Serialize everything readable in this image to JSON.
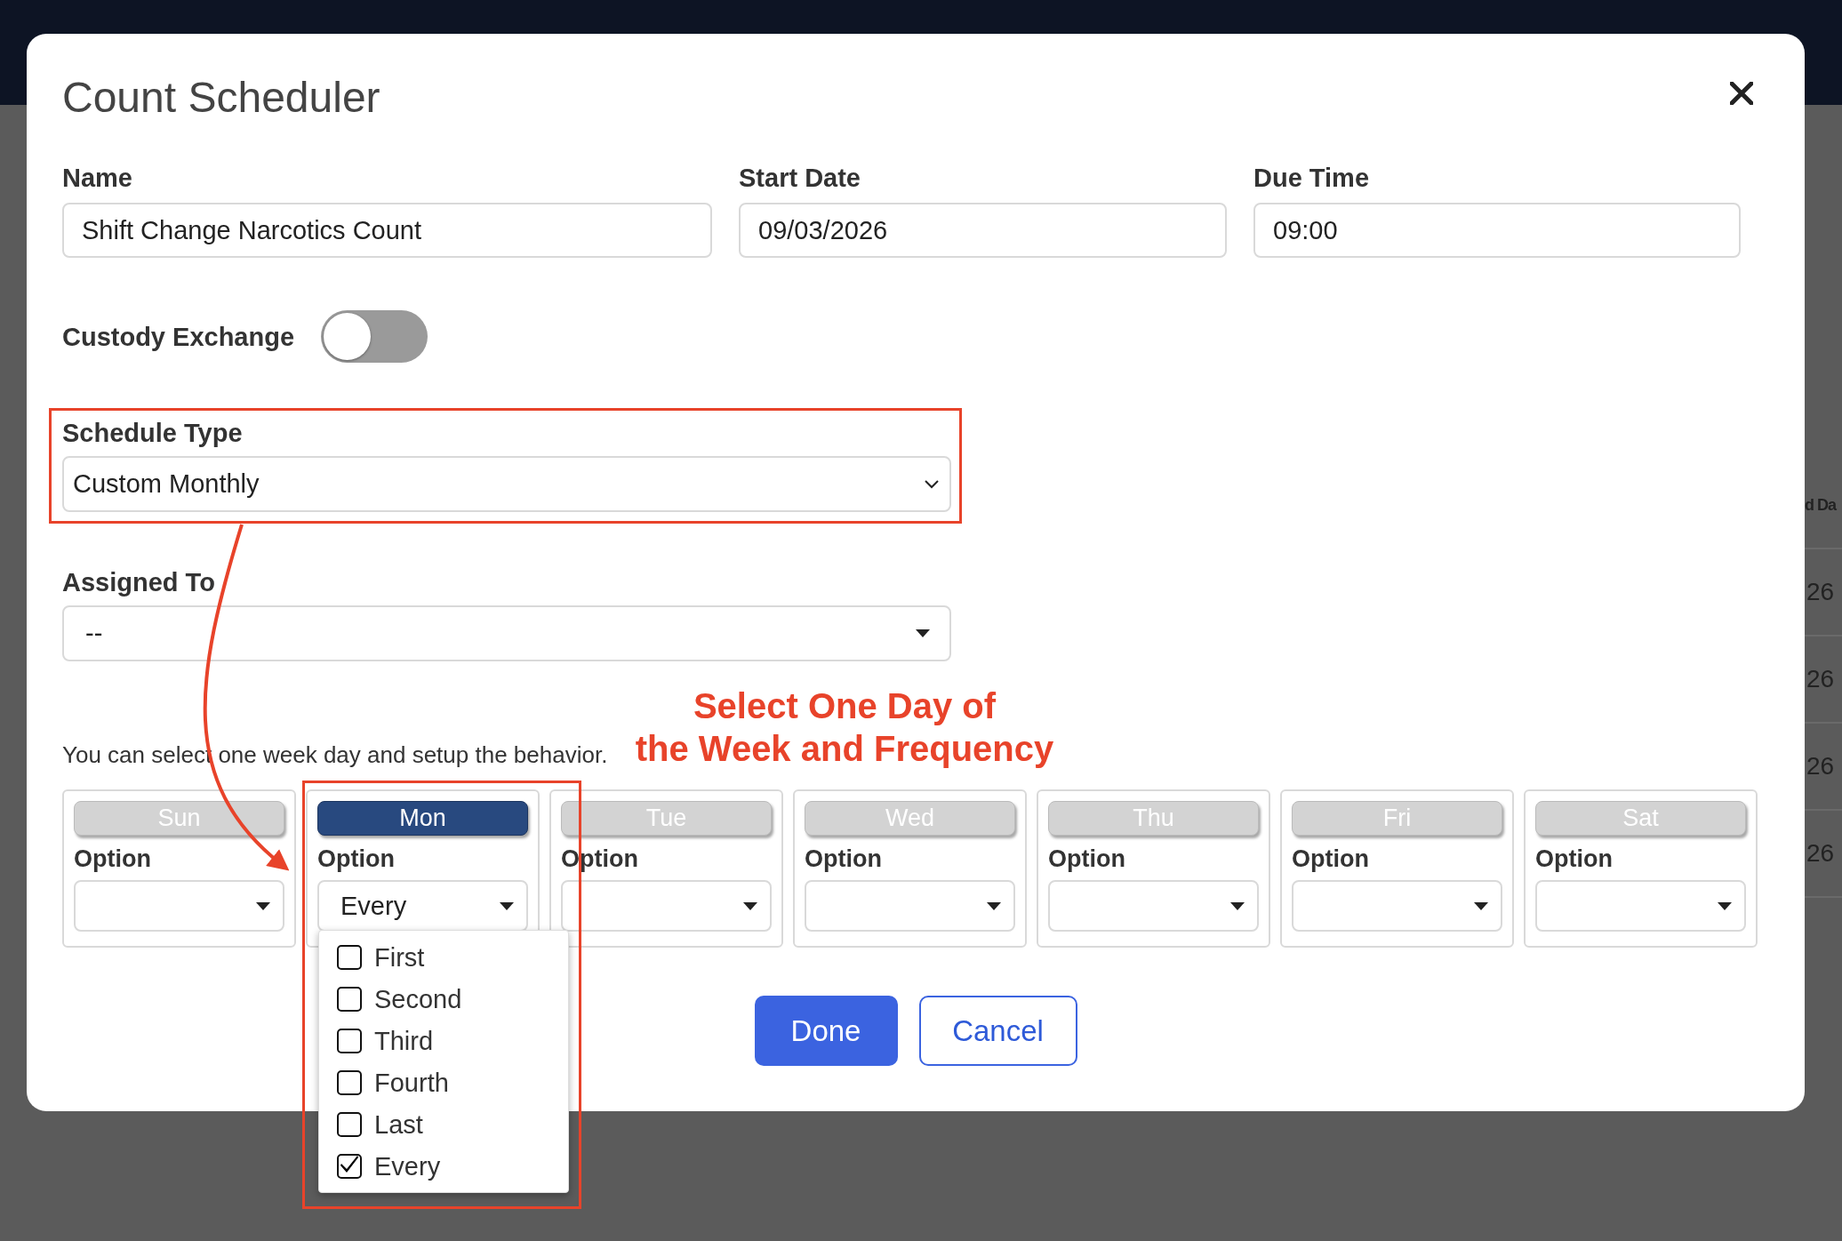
{
  "modal": {
    "title": "Count Scheduler"
  },
  "fields": [
    {
      "label": "Name",
      "value": "Shift Change Narcotics Count"
    },
    {
      "label": "Start Date",
      "value": "09/03/2026"
    },
    {
      "label": "Due Time",
      "value": "09:00"
    }
  ],
  "custody_exchange": {
    "label": "Custody Exchange",
    "on": false
  },
  "schedule_type": {
    "label": "Schedule Type",
    "value": "Custom Monthly"
  },
  "assigned_to": {
    "label": "Assigned To",
    "value": "--"
  },
  "helper_text": "You can select one week day and setup the behavior.",
  "days": [
    {
      "label": "Sun",
      "selected": false,
      "option_label": "Option"
    },
    {
      "label": "Mon",
      "selected": true,
      "option_label": "Option",
      "value": "Every",
      "menu": [
        {
          "label": "First",
          "checked": false
        },
        {
          "label": "Second",
          "checked": false
        },
        {
          "label": "Third",
          "checked": false
        },
        {
          "label": "Fourth",
          "checked": false
        },
        {
          "label": "Last",
          "checked": false
        },
        {
          "label": "Every",
          "checked": true
        }
      ]
    },
    {
      "label": "Tue",
      "selected": false,
      "option_label": "Option"
    },
    {
      "label": "Wed",
      "selected": false,
      "option_label": "Option"
    },
    {
      "label": "Thu",
      "selected": false,
      "option_label": "Option"
    },
    {
      "label": "Fri",
      "selected": false,
      "option_label": "Option"
    },
    {
      "label": "Sat",
      "selected": false,
      "option_label": "Option"
    }
  ],
  "buttons": [
    {
      "label": "Done",
      "kind": "primary"
    },
    {
      "label": "Cancel",
      "kind": "secondary"
    }
  ],
  "annotation": {
    "lines": [
      "Select One Day of",
      "the Week and Frequency"
    ]
  },
  "background_table": {
    "header": "d Da",
    "cells": [
      "26",
      "26",
      "26",
      "26"
    ]
  }
}
